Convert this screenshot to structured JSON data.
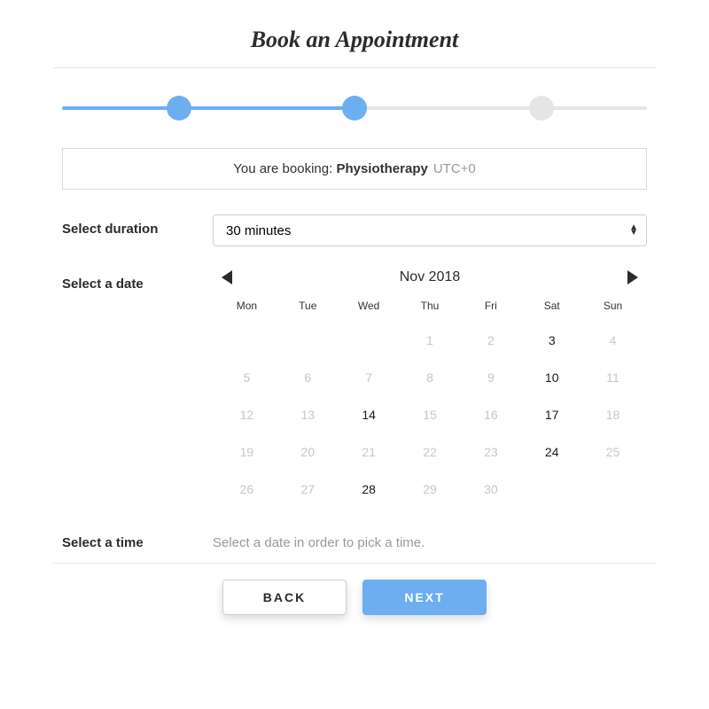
{
  "title": "Book an Appointment",
  "stepper": {
    "current": 2,
    "total": 3,
    "fill_percent": 50
  },
  "booking_info": {
    "prefix": "You are booking: ",
    "service": "Physiotherapy",
    "timezone": "UTC+0"
  },
  "duration": {
    "label": "Select duration",
    "selected": "30 minutes",
    "options": [
      "30 minutes"
    ]
  },
  "date": {
    "label": "Select a date",
    "month_label": "Nov 2018",
    "weekdays": [
      "Mon",
      "Tue",
      "Wed",
      "Thu",
      "Fri",
      "Sat",
      "Sun"
    ],
    "days": [
      {
        "d": "",
        "a": false
      },
      {
        "d": "",
        "a": false
      },
      {
        "d": "",
        "a": false
      },
      {
        "d": "1",
        "a": false
      },
      {
        "d": "2",
        "a": false
      },
      {
        "d": "3",
        "a": true
      },
      {
        "d": "4",
        "a": false
      },
      {
        "d": "5",
        "a": false
      },
      {
        "d": "6",
        "a": false
      },
      {
        "d": "7",
        "a": false
      },
      {
        "d": "8",
        "a": false
      },
      {
        "d": "9",
        "a": false
      },
      {
        "d": "10",
        "a": true
      },
      {
        "d": "11",
        "a": false
      },
      {
        "d": "12",
        "a": false
      },
      {
        "d": "13",
        "a": false
      },
      {
        "d": "14",
        "a": true
      },
      {
        "d": "15",
        "a": false
      },
      {
        "d": "16",
        "a": false
      },
      {
        "d": "17",
        "a": true
      },
      {
        "d": "18",
        "a": false
      },
      {
        "d": "19",
        "a": false
      },
      {
        "d": "20",
        "a": false
      },
      {
        "d": "21",
        "a": false
      },
      {
        "d": "22",
        "a": false
      },
      {
        "d": "23",
        "a": false
      },
      {
        "d": "24",
        "a": true
      },
      {
        "d": "25",
        "a": false
      },
      {
        "d": "26",
        "a": false
      },
      {
        "d": "27",
        "a": false
      },
      {
        "d": "28",
        "a": true
      },
      {
        "d": "29",
        "a": false
      },
      {
        "d": "30",
        "a": false
      },
      {
        "d": "",
        "a": false
      },
      {
        "d": "",
        "a": false
      }
    ]
  },
  "time": {
    "label": "Select a time",
    "hint": "Select a date in order to pick a time."
  },
  "actions": {
    "back": "BACK",
    "next": "NEXT"
  },
  "colors": {
    "accent": "#6daef0",
    "muted": "#c7c7c7",
    "border": "#d9d9d9"
  }
}
